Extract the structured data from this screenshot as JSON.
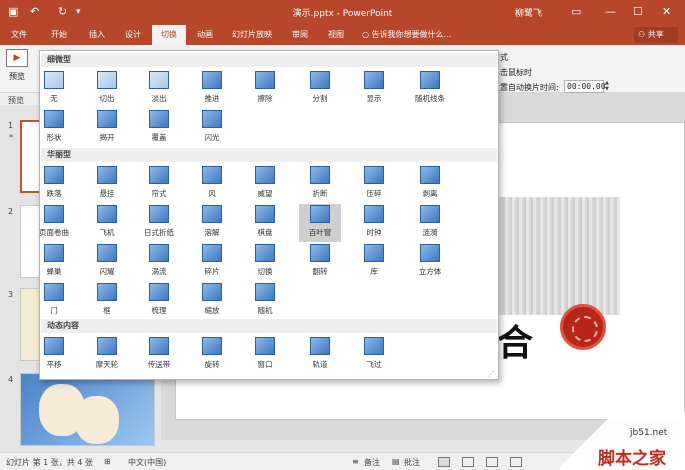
{
  "window": {
    "title": "演示.pptx - PowerPoint",
    "user": "柳鹭飞"
  },
  "titlebar_icons": {
    "save": "save-icon",
    "undo": "undo-icon",
    "redo": "redo-icon",
    "customize": "qat-customize-icon"
  },
  "window_controls": {
    "options": "ribbon-display-icon",
    "minimize": "minimize-icon",
    "maximize": "maximize-icon",
    "close": "close-icon"
  },
  "tabs": [
    {
      "label": "文件"
    },
    {
      "label": "开始"
    },
    {
      "label": "插入"
    },
    {
      "label": "设计"
    },
    {
      "label": "切换",
      "active": true
    },
    {
      "label": "动画"
    },
    {
      "label": "幻灯片放映"
    },
    {
      "label": "审阅"
    },
    {
      "label": "视图"
    }
  ],
  "tell_me": "告诉我你想要做什么...",
  "share": "共享",
  "ribbon": {
    "preview_label": "预览",
    "timing_labels": [
      "方式",
      "单击鼠标时",
      "设置自动换片时间:"
    ],
    "auto_time": "00:00.00"
  },
  "row_label": "预览",
  "thumbnails": [
    {
      "number": "1",
      "star": "*"
    },
    {
      "number": "2"
    },
    {
      "number": "3"
    },
    {
      "number": "4"
    }
  ],
  "slide": {
    "char": "合"
  },
  "gallery": {
    "sections": [
      {
        "label": "细微型",
        "items": [
          "无",
          "切出",
          "淡出",
          "推进",
          "擦除",
          "分割",
          "显示",
          "随机线条",
          "形状",
          "揭开",
          "覆盖",
          "闪光"
        ]
      },
      {
        "label": "华丽型",
        "items": [
          "跌落",
          "悬挂",
          "帘式",
          "风",
          "威望",
          "折断",
          "压碎",
          "剥离",
          "页面卷曲",
          "飞机",
          "日式折纸",
          "溶解",
          "棋盘",
          "百叶窗",
          "时钟",
          "涟漪",
          "蜂巢",
          "闪耀",
          "涡流",
          "碎片",
          "切换",
          "翻转",
          "库",
          "立方体",
          "门",
          "框",
          "梳理",
          "缩放",
          "随机"
        ]
      },
      {
        "label": "动态内容",
        "items": [
          "平移",
          "摩天轮",
          "传送带",
          "旋转",
          "窗口",
          "轨道",
          "飞过"
        ]
      }
    ],
    "selected": "百叶窗",
    "item_icon": "transition-effect-icon",
    "resize_grip": "⋰"
  },
  "status": {
    "slide_info": "幻灯片 第 1 张，共 4 张",
    "language": "中文(中国)",
    "notes": "备注",
    "comments": "批注"
  },
  "watermark": {
    "url": "jb51.net",
    "name": "脚本之家"
  }
}
